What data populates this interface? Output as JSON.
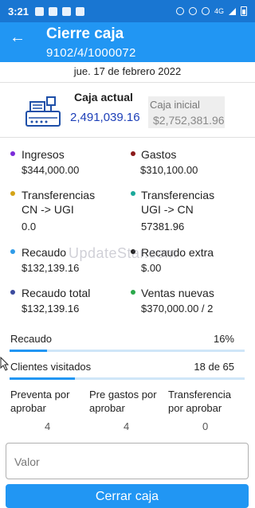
{
  "status_bar": {
    "time": "3:21",
    "network": "4G"
  },
  "header": {
    "title": "Cierre caja",
    "subtitle": "9102/4/1000072"
  },
  "date": "jue. 17 de febrero 2022",
  "caja": {
    "actual_label": "Caja actual",
    "actual_value": "2,491,039.16",
    "inicial_label": "Caja inicial",
    "inicial_value": "$2,752,381.96"
  },
  "stats": [
    {
      "label": "Ingresos",
      "value": "$344,000.00",
      "color": "#7b2bd9"
    },
    {
      "label": "Gastos",
      "value": "$310,100.00",
      "color": "#8b1a1a"
    },
    {
      "label": "Transferencias\nCN -> UGI",
      "value": "0.0",
      "color": "#d4a317"
    },
    {
      "label": "Transferencias\nUGI -> CN",
      "value": "57381.96",
      "color": "#1aa89a"
    },
    {
      "label": "Recaudo",
      "value": "$132,139.16",
      "color": "#2f9be8"
    },
    {
      "label": "Recaudo extra",
      "value": "$.00",
      "color": "#222222"
    },
    {
      "label": "Recaudo total",
      "value": "$132,139.16",
      "color": "#3b4a9e"
    },
    {
      "label": "Ventas nuevas",
      "value": "$370,000.00 / 2",
      "color": "#2aa84a"
    }
  ],
  "watermark": "UpdateStar.com",
  "progress": {
    "recaudo_label": "Recaudo",
    "recaudo_value": "16%",
    "recaudo_fraction": 0.16,
    "clientes_label": "Clientes visitados",
    "clientes_value": "18 de 65",
    "clientes_fraction": 0.277
  },
  "pending": [
    {
      "label": "Preventa por\naprobar",
      "count": "4"
    },
    {
      "label": "Pre gastos por\naprobar",
      "count": "4"
    },
    {
      "label": "Transferencia\npor aprobar",
      "count": "0"
    }
  ],
  "input": {
    "placeholder": "Valor",
    "value": ""
  },
  "button": {
    "label": "Cerrar caja"
  },
  "colors": {
    "primary": "#2196f3",
    "status_bar": "#1976d2",
    "caja_value": "#1e40b8"
  }
}
